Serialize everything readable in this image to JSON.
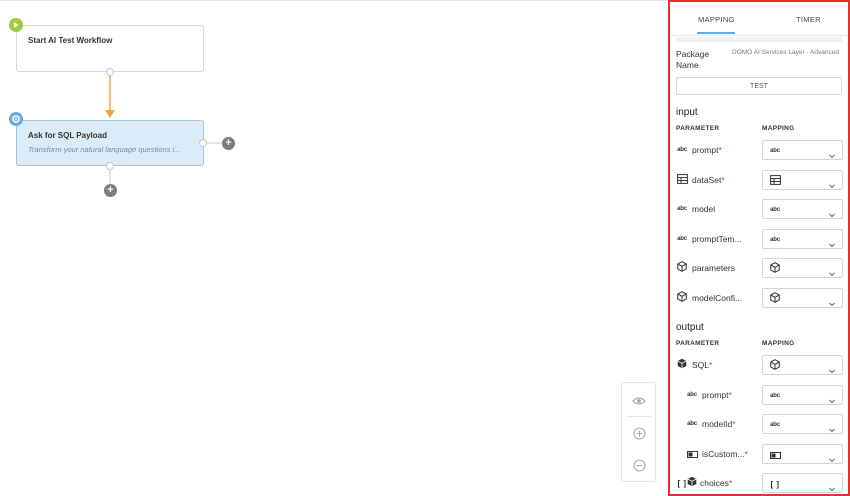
{
  "canvas": {
    "start_node": {
      "title": "Start AI Test Workflow",
      "icon": "play-icon"
    },
    "ask_node": {
      "title": "Ask for SQL Payload",
      "subtitle": "Transform your natural language questions i...",
      "icon": "gear-icon"
    },
    "colors": {
      "connector": "#f0a640",
      "ask_node_fill": "#dcebf8",
      "start_badge": "#9ccc3c",
      "ask_badge": "#6aaadc"
    }
  },
  "zoom_controls": {
    "view_icon": "eye-icon",
    "zoom_in_icon": "zoom-in-icon",
    "zoom_out_icon": "zoom-out-icon"
  },
  "panel": {
    "tabs": [
      {
        "label": "MAPPING",
        "active": true
      },
      {
        "label": "TIMER",
        "active": false
      }
    ],
    "package_label": "Package Name",
    "package_value": "DOMO AI Services Layer - Advanced",
    "test_button": "TEST",
    "input": {
      "title": "input",
      "col_parameter": "PARAMETER",
      "col_mapping": "MAPPING",
      "rows": [
        {
          "name": "prompt",
          "required": true,
          "type_icon": "text-type-icon",
          "map_icon": "text-type-icon"
        },
        {
          "name": "dataSet",
          "required": true,
          "type_icon": "table-icon",
          "map_icon": "table-icon"
        },
        {
          "name": "model",
          "required": false,
          "type_icon": "text-type-icon",
          "map_icon": "text-type-icon"
        },
        {
          "name": "promptTem...",
          "required": false,
          "type_icon": "text-type-icon",
          "map_icon": "text-type-icon"
        },
        {
          "name": "parameters",
          "required": false,
          "type_icon": "cube-icon",
          "map_icon": "cube-icon"
        },
        {
          "name": "modelConfi...",
          "required": false,
          "type_icon": "cube-icon",
          "map_icon": "cube-icon"
        }
      ]
    },
    "output": {
      "title": "output",
      "col_parameter": "PARAMETER",
      "col_mapping": "MAPPING",
      "rows": [
        {
          "name": "SQL",
          "required": true,
          "type_icon": "cube-filled-icon",
          "map_icon": "cube-icon",
          "indent": 0
        },
        {
          "name": "prompt",
          "required": true,
          "type_icon": "text-type-icon",
          "map_icon": "text-type-icon",
          "indent": 1
        },
        {
          "name": "modelId",
          "required": true,
          "type_icon": "text-type-icon",
          "map_icon": "text-type-icon",
          "indent": 1
        },
        {
          "name": "isCustom...",
          "required": true,
          "type_icon": "toggle-icon",
          "map_icon": "toggle-icon",
          "indent": 1
        },
        {
          "name": "choices",
          "required": true,
          "type_icon": "array-cube-icon",
          "map_icon": "array-icon",
          "indent": 0
        }
      ]
    },
    "abc_glyph": "abc",
    "array_glyph": "[ ]",
    "required_mark": "*",
    "accent": "#5fb0e8",
    "highlight_border": "#e0332e"
  }
}
